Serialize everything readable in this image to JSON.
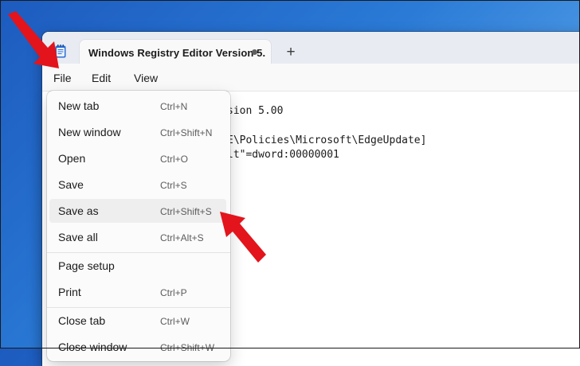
{
  "window": {
    "tab_title": "Windows Registry Editor Version 5.",
    "new_tab_symbol": "+",
    "app_icon": "notepad-icon",
    "unsaved_indicator": "modified-dot-icon"
  },
  "menubar": {
    "file": "File",
    "edit": "Edit",
    "view": "View"
  },
  "editor": {
    "lines": [
      "sion 5.00",
      "E\\Policies\\Microsoft\\EdgeUpdate]",
      "lt\"=dword:00000001"
    ]
  },
  "file_menu": {
    "items": [
      {
        "label": "New tab",
        "shortcut": "Ctrl+N"
      },
      {
        "label": "New window",
        "shortcut": "Ctrl+Shift+N"
      },
      {
        "label": "Open",
        "shortcut": "Ctrl+O"
      },
      {
        "label": "Save",
        "shortcut": "Ctrl+S"
      },
      {
        "label": "Save as",
        "shortcut": "Ctrl+Shift+S",
        "highlighted": true
      },
      {
        "label": "Save all",
        "shortcut": "Ctrl+Alt+S"
      },
      {
        "label": "Page setup",
        "shortcut": ""
      },
      {
        "label": "Print",
        "shortcut": "Ctrl+P"
      },
      {
        "label": "Close tab",
        "shortcut": "Ctrl+W"
      },
      {
        "label": "Close window",
        "shortcut": "Ctrl+Shift+W"
      }
    ]
  },
  "colors": {
    "annotation_arrow": "#e3141b",
    "highlight": "#eeeeee",
    "desktop_blue": "#2a7ad6"
  }
}
